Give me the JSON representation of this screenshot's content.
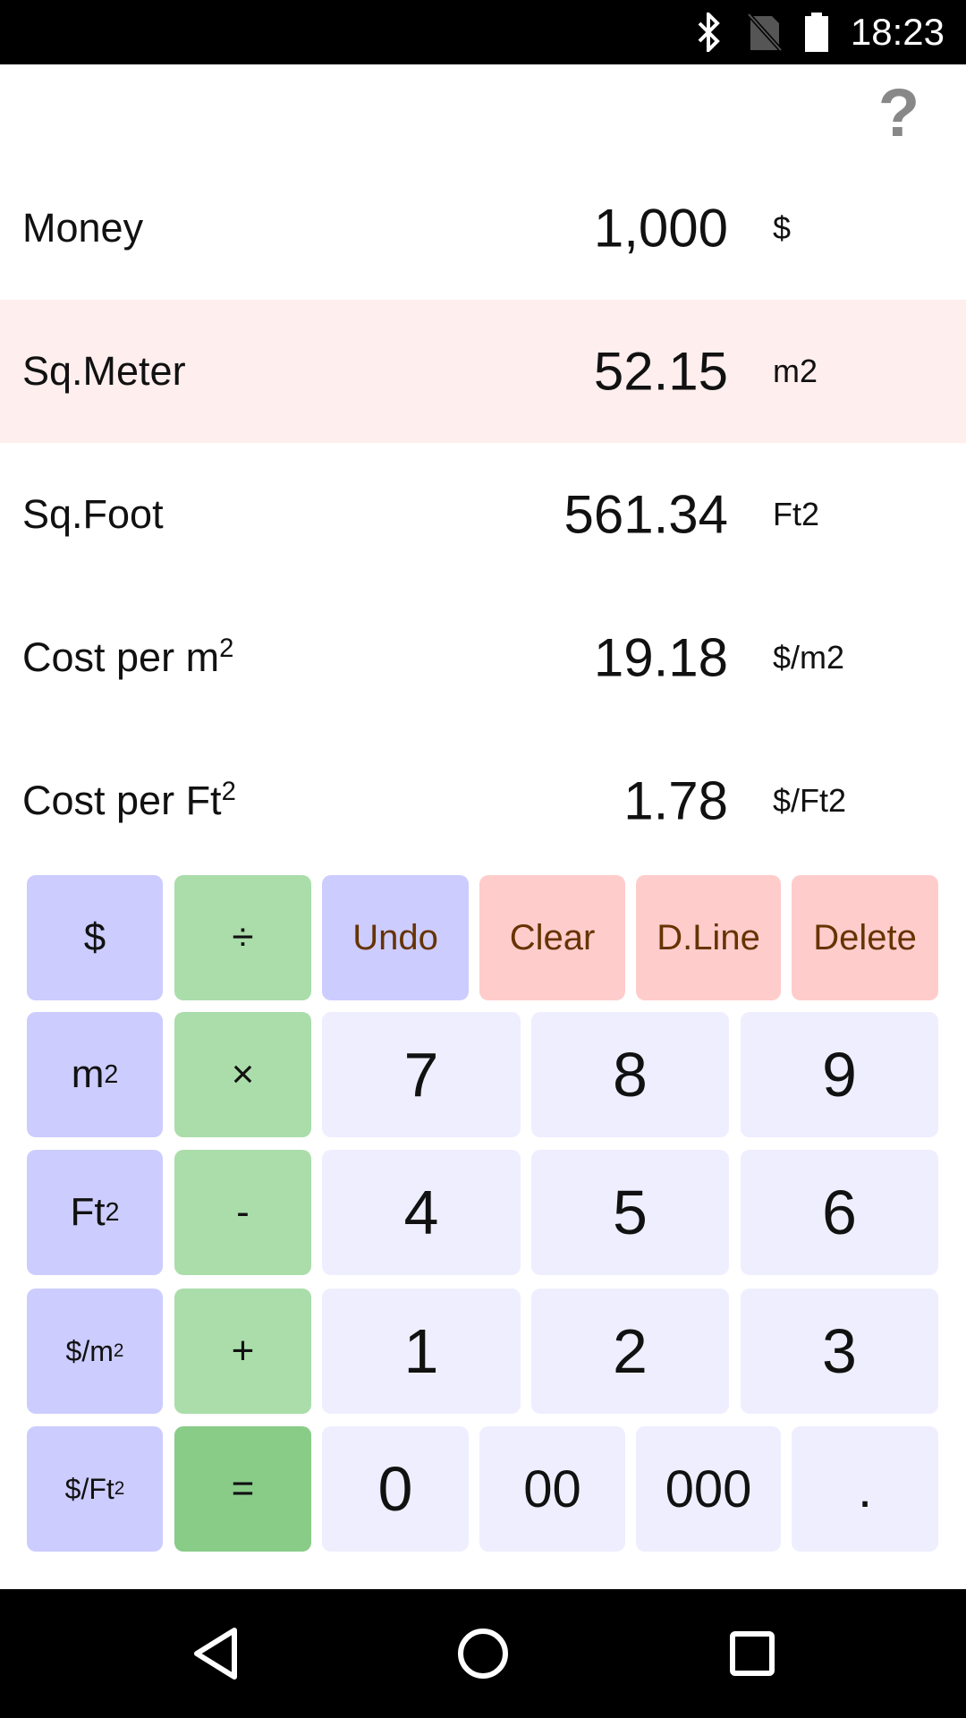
{
  "status_bar": {
    "time": "18:23",
    "icons": [
      "bluetooth-icon",
      "no-sim-icon",
      "battery-full-icon"
    ]
  },
  "header": {
    "help_icon": "question-mark-icon"
  },
  "rows": [
    {
      "label": "Money",
      "label_sup": "",
      "value": "1,000",
      "unit": "$",
      "highlighted": false
    },
    {
      "label": "Sq.Meter",
      "label_sup": "",
      "value": "52.15",
      "unit": "m2",
      "highlighted": true
    },
    {
      "label": "Sq.Foot",
      "label_sup": "",
      "value": "561.34",
      "unit": "Ft2",
      "highlighted": false
    },
    {
      "label": "Cost per m",
      "label_sup": "2",
      "value": "19.18",
      "unit": "$/m2",
      "highlighted": false
    },
    {
      "label": "Cost per Ft",
      "label_sup": "2",
      "value": "1.78",
      "unit": "$/Ft2",
      "highlighted": false
    }
  ],
  "keypad": {
    "unit_keys": [
      {
        "base": "$",
        "sup": ""
      },
      {
        "base": "m",
        "sup": "2"
      },
      {
        "base": "Ft",
        "sup": "2"
      },
      {
        "base": "$/m",
        "sup": "2"
      },
      {
        "base": "$/Ft",
        "sup": "2"
      }
    ],
    "operators": [
      "÷",
      "×",
      "-",
      "+",
      "="
    ],
    "function_keys": [
      "Undo",
      "Clear",
      "D.Line",
      "Delete"
    ],
    "digits_rows": [
      [
        "7",
        "8",
        "9"
      ],
      [
        "4",
        "5",
        "6"
      ],
      [
        "1",
        "2",
        "3"
      ]
    ],
    "bottom_keys": [
      "0",
      "00",
      "000",
      "."
    ]
  },
  "colors": {
    "unit_key": "#ccccff",
    "operator_key": "#aaddaa",
    "equals_key": "#88cc88",
    "function_key_red": "#ffcccc",
    "digit_key": "#eeeeff",
    "function_text": "#663300",
    "highlight_row": "#ffeeee"
  },
  "nav_bar": {
    "icons": [
      "back-icon",
      "home-icon",
      "recents-icon"
    ]
  }
}
